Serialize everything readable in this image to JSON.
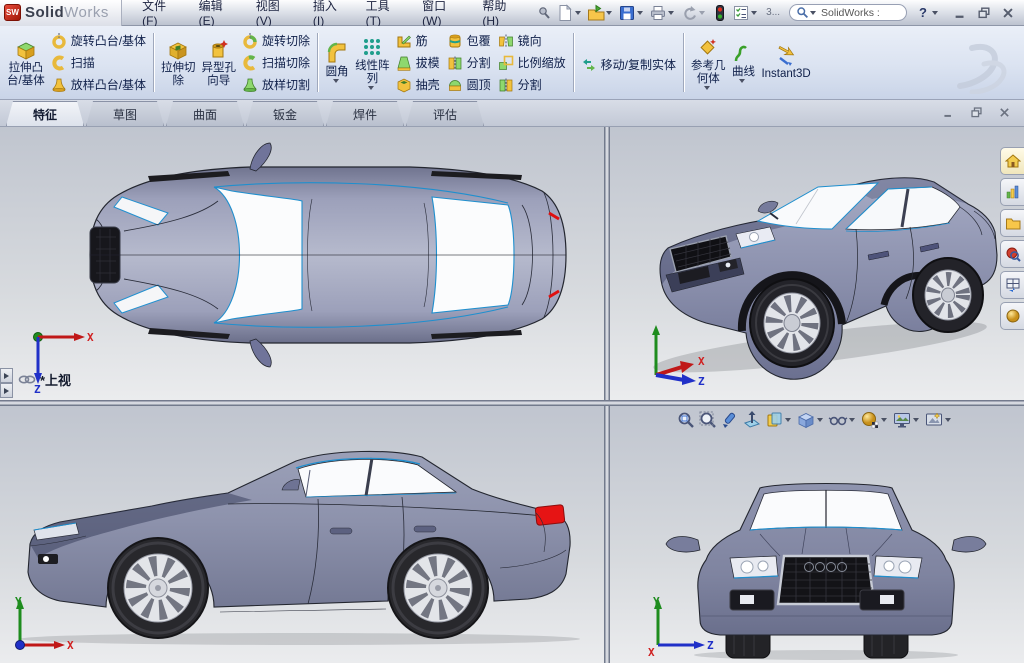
{
  "titlebar": {
    "logo_badge": "SW",
    "app_name_bold": "Solid",
    "app_name_light": "Works",
    "menus": [
      "文件(F)",
      "编辑(E)",
      "视图(V)",
      "插入(I)",
      "工具(T)",
      "窗口(W)",
      "帮助(H)"
    ],
    "overflow": "3...",
    "search_value": "SolidWorks :",
    "help_glyph": "?"
  },
  "commandbar": {
    "extrude_boss": {
      "l1": "拉伸凸",
      "l2": "台/基体"
    },
    "revolve_boss": "旋转凸台/基体",
    "sweep": "扫描",
    "loft_boss": "放样凸台/基体",
    "extrude_cut": {
      "l1": "拉伸切",
      "l2": "除"
    },
    "hole_wizard": {
      "l1": "异型孔",
      "l2": "向导"
    },
    "revolve_cut": "旋转切除",
    "sweep_cut": "扫描切除",
    "loft_cut": "放样切割",
    "fillet": "圆角",
    "linear_pattern": {
      "l1": "线性阵",
      "l2": "列"
    },
    "rib": "筋",
    "draft": "拔模",
    "shell": "抽壳",
    "wrap": "包覆",
    "split_a": "分割",
    "dome": "圆顶",
    "mirror": "镜向",
    "scale": "比例缩放",
    "split_b": "分割",
    "move_copy": "移动/复制实体",
    "ref_geometry": {
      "l1": "参考几",
      "l2": "何体"
    },
    "curves": "曲线",
    "instant3d": "Instant3D"
  },
  "tabs": {
    "items": [
      "特征",
      "草图",
      "曲面",
      "钣金",
      "焊件",
      "评估"
    ],
    "active": "特征"
  },
  "viewport": {
    "view_label": "*上视",
    "axes": {
      "x": "X",
      "y": "Y",
      "z": "Z"
    }
  },
  "icons": {
    "headsup": [
      "zoom-to-fit",
      "zoom-to-area",
      "previous-view",
      "section-view",
      "view-orientation",
      "display-style",
      "hide-show-items",
      "edit-appearance",
      "apply-scene",
      "view-settings"
    ],
    "taskpane": [
      "solidworks-resources",
      "design-library",
      "file-explorer",
      "solidworks-search",
      "view-palette",
      "appearances"
    ]
  },
  "colors": {
    "accent_blue": "#1f8fce",
    "car_body": "#8d92ac",
    "taillight": "#e61414",
    "toolbar_bg": "#dbe3f1"
  }
}
